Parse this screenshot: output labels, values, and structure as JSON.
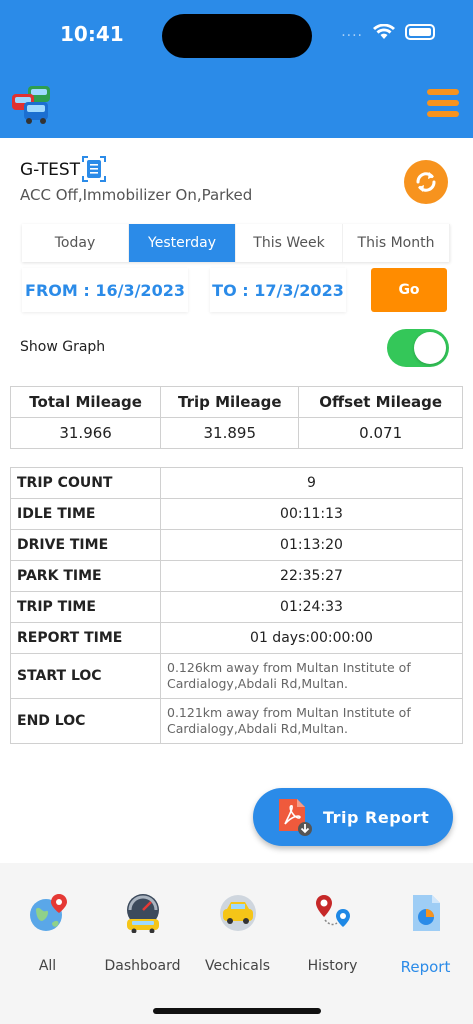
{
  "status_bar": {
    "time": "10:41",
    "signal_dots": "...."
  },
  "header": {
    "logo": "car-logo-icon",
    "menu": "hamburger-icon"
  },
  "vehicle": {
    "name": "G-TEST",
    "status": "ACC Off,Immobilizer On,Parked"
  },
  "tabs": [
    {
      "label": "Today"
    },
    {
      "label": "Yesterday",
      "active": true
    },
    {
      "label": "This Week"
    },
    {
      "label": "This Month"
    }
  ],
  "dates": {
    "from": "FROM : 16/3/2023",
    "to": "TO : 17/3/2023",
    "go": "Go"
  },
  "graph": {
    "label": "Show Graph",
    "enabled": true
  },
  "mileage": {
    "headers": [
      "Total Mileage",
      "Trip Mileage",
      "Offset Mileage"
    ],
    "values": [
      "31.966",
      "31.895",
      "0.071"
    ]
  },
  "stats": [
    {
      "key": "TRIP COUNT",
      "value": "9"
    },
    {
      "key": "IDLE TIME",
      "value": "00:11:13"
    },
    {
      "key": "DRIVE TIME",
      "value": "01:13:20"
    },
    {
      "key": "PARK TIME",
      "value": "22:35:27"
    },
    {
      "key": "TRIP TIME",
      "value": "01:24:33"
    },
    {
      "key": "REPORT TIME",
      "value": "01 days:00:00:00"
    },
    {
      "key": "START LOC",
      "value": "0.126km away from Multan Institute of Cardialogy,Abdali Rd,Multan."
    },
    {
      "key": "END LOC",
      "value": "0.121km away from Multan Institute of Cardialogy,Abdali Rd,Multan."
    }
  ],
  "trip_report": {
    "label": "Trip Report"
  },
  "nav": [
    {
      "label": "All",
      "icon": "globe-location-icon"
    },
    {
      "label": "Dashboard",
      "icon": "speedometer-icon"
    },
    {
      "label": "Vechicals",
      "icon": "vehicle-icon"
    },
    {
      "label": "History",
      "icon": "map-pins-icon"
    },
    {
      "label": "Report",
      "icon": "report-chart-icon",
      "active": true
    }
  ],
  "colors": {
    "primary": "#2b8be8",
    "accent": "#f7931e",
    "go": "#ff8c00",
    "toggle_on": "#34c759"
  }
}
